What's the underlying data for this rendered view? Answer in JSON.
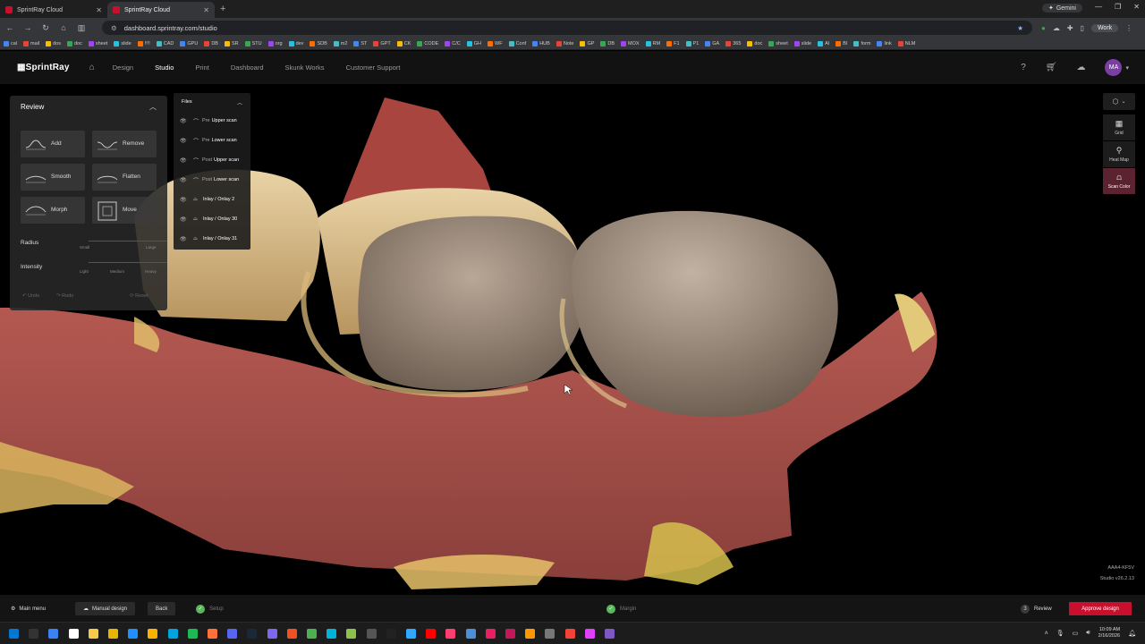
{
  "browser": {
    "tabs": [
      {
        "label": "SprintRay Cloud",
        "active": false
      },
      {
        "label": "SprintRay Cloud",
        "active": true
      }
    ],
    "url": "dashboard.sprintray.com/studio",
    "gemini_label": "Gemini",
    "profile_label": "Work",
    "bookmarks": [
      "cal",
      "mail",
      "dos",
      "doc",
      "sheet",
      "slide",
      "!!!!",
      "CAD",
      "GPU",
      "DB",
      "SR",
      "STU",
      "org",
      "dev",
      "SDB",
      "m2",
      "ST",
      "GPT",
      "CK",
      "CODE",
      "C/C",
      "GH",
      "WF",
      "Conf",
      "HUB",
      "Note",
      "GP",
      "DB",
      "MOX",
      "RM",
      "F1",
      "P1",
      "GA",
      "365",
      "doc",
      "sheet",
      "slide",
      "AI",
      "BI",
      "form",
      "link",
      "NLM"
    ]
  },
  "app": {
    "logo": "SprintRay",
    "nav": [
      {
        "label": "Design",
        "active": false
      },
      {
        "label": "Studio",
        "active": true
      },
      {
        "label": "Print",
        "active": false
      },
      {
        "label": "Dashboard",
        "active": false
      },
      {
        "label": "Skunk Works",
        "active": false
      },
      {
        "label": "Customer Support",
        "active": false
      }
    ],
    "avatar_initials": "MA",
    "brand_color": "#c8102e"
  },
  "review_panel": {
    "title": "Review",
    "tools": [
      "Add",
      "Remove",
      "Smooth",
      "Flatten",
      "Morph",
      "Move"
    ],
    "radius": {
      "label": "Radius",
      "min_label": "Small",
      "max_label": "Large"
    },
    "intensity": {
      "label": "Intensity",
      "ticks": [
        "Light",
        "Medium",
        "Heavy"
      ]
    },
    "undo": "Undo",
    "redo": "Redo",
    "reset": "Reset"
  },
  "files_panel": {
    "title": "Files",
    "items": [
      {
        "prefix": "Pre",
        "label": "Upper scan"
      },
      {
        "prefix": "Pre",
        "label": "Lower scan"
      },
      {
        "prefix": "Post",
        "label": "Upper scan"
      },
      {
        "prefix": "Post",
        "label": "Lower scan"
      },
      {
        "prefix": "",
        "label": "Inlay / Onlay  2"
      },
      {
        "prefix": "",
        "label": "Inlay / Onlay  30"
      },
      {
        "prefix": "",
        "label": "Inlay / Onlay  31"
      }
    ]
  },
  "right_toolbar": {
    "grid": "Grid",
    "heatmap": "Heat Map",
    "scancolor": "Scan Color"
  },
  "viewport": {
    "case_id": "AAA4-KF5V",
    "version": "Studio v26.2.13"
  },
  "bottom_bar": {
    "main_menu": "Main menu",
    "manual_design": "Manual design",
    "back": "Back",
    "steps": [
      {
        "label": "Setup",
        "state": "done"
      },
      {
        "label": "Margin",
        "state": "done"
      },
      {
        "label": "Review",
        "number": "3",
        "state": "current"
      }
    ],
    "approve": "Approve design"
  },
  "taskbar": {
    "time": "10:09 AM",
    "date": "2/16/2026"
  }
}
